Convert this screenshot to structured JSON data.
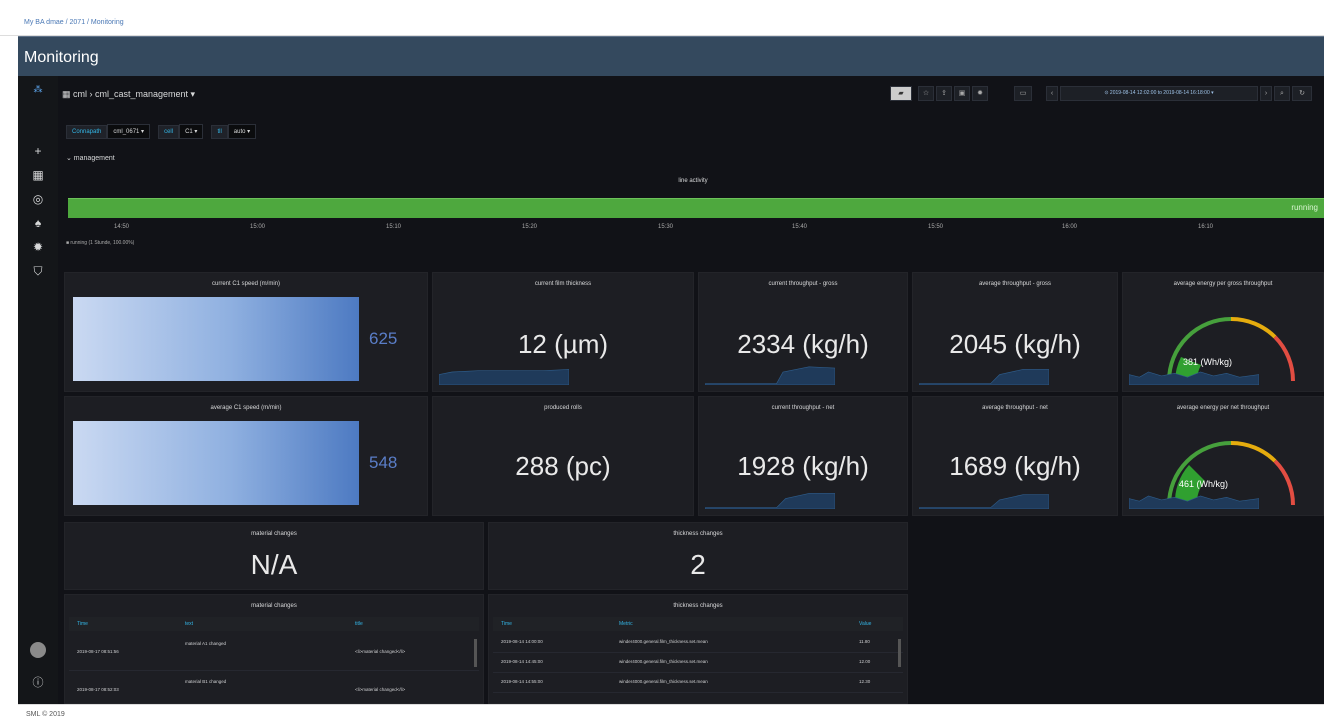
{
  "breadcrumb": "My BA dmae / 2071 / Monitoring",
  "page_title": "Monitoring",
  "dashboard": {
    "crumb": "cml › cml_cast_management ▾",
    "time_range": "⊙ 2019-08-14 12:02:00 to 2019-08-14 16:18:00 ▾"
  },
  "variables": [
    {
      "label": "Connapath",
      "value": "cml_0671 ▾"
    },
    {
      "label": "cell",
      "value": "C1 ▾"
    },
    {
      "label": "tll",
      "value": "auto ▾"
    }
  ],
  "row_title": "⌄ management",
  "line_activity": {
    "title": "line activity",
    "state_label": "running",
    "ticks": [
      "14:50",
      "15:00",
      "15:10",
      "15:20",
      "15:30",
      "15:40",
      "15:50",
      "16:00",
      "16:10"
    ],
    "legend": "■ running (1 Stunde, 100.00%)"
  },
  "speed_panels": [
    {
      "title": "current C1 speed (m/min)",
      "value": "625",
      "fill": 1.0
    },
    {
      "title": "average C1 speed (m/min)",
      "value": "548",
      "fill": 1.0
    }
  ],
  "stat_panels": [
    {
      "title": "current film thickness",
      "value": "12 (µm)"
    },
    {
      "title": "current throughput - gross",
      "value": "2334 (kg/h)"
    },
    {
      "title": "average throughput - gross",
      "value": "2045 (kg/h)"
    },
    {
      "title": "produced rolls",
      "value": "288 (pc)"
    },
    {
      "title": "current throughput - net",
      "value": "1928 (kg/h)"
    },
    {
      "title": "average throughput - net",
      "value": "1689 (kg/h)"
    }
  ],
  "gauges": [
    {
      "title": "average energy per gross throughput",
      "value": "381 (Wh/kg)",
      "level": 0.38
    },
    {
      "title": "average energy per net throughput",
      "value": "461 (Wh/kg)",
      "level": 0.46
    }
  ],
  "change_stats": [
    {
      "title": "material changes",
      "value": "N/A"
    },
    {
      "title": "thickness changes",
      "value": "2"
    }
  ],
  "material_table": {
    "title": "material changes",
    "headers": [
      "Time",
      "text",
      "title"
    ],
    "rows": [
      [
        "2019-08-17 08:51:56",
        "material A1 changed",
        "<li>material changed</li>"
      ],
      [
        "2019-08-17 08:52:03",
        "material B1 changed",
        "<li>material changed</li>"
      ]
    ]
  },
  "thickness_table": {
    "title": "thickness changes",
    "headers": [
      "Time",
      "Metric",
      "Value"
    ],
    "rows": [
      [
        "2019-08-14 14:00:00",
        "winder4000.general.film_thickness.set.mean",
        "11.80"
      ],
      [
        "2019-08-14 14:45:00",
        "winder4000.general.film_thickness.set.mean",
        "12.00"
      ],
      [
        "2019-08-14 14:55:00",
        "winder4000.general.film_thickness.set.mean",
        "12.30"
      ]
    ]
  },
  "footer": {
    "left": "SML © 2019"
  }
}
